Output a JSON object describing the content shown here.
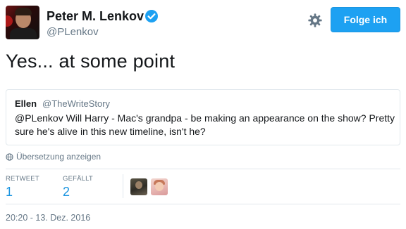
{
  "author": {
    "name": "Peter M. Lenkov",
    "handle": "@PLenkov",
    "verified": true
  },
  "header": {
    "follow_label": "Folge ich",
    "settings_icon": "gear-icon"
  },
  "tweet": {
    "text": "Yes... at some point"
  },
  "quoted_tweet": {
    "name": "Ellen",
    "handle": "@TheWriteStory",
    "text": "@PLenkov Will Harry - Mac's grandpa - be making an appearance on the show? Pretty sure he's alive in this new timeline, isn't he?"
  },
  "translate_label": "Übersetzung anzeigen",
  "stats": {
    "retweets_label": "RETWEET",
    "retweets_value": "1",
    "likes_label": "GEFÄLLT",
    "likes_value": "2"
  },
  "timestamp": "20:20 - 13. Dez. 2016",
  "colors": {
    "accent": "#1da1f2",
    "link": "#1b95e0",
    "muted": "#657786",
    "border": "#e1e8ed"
  }
}
